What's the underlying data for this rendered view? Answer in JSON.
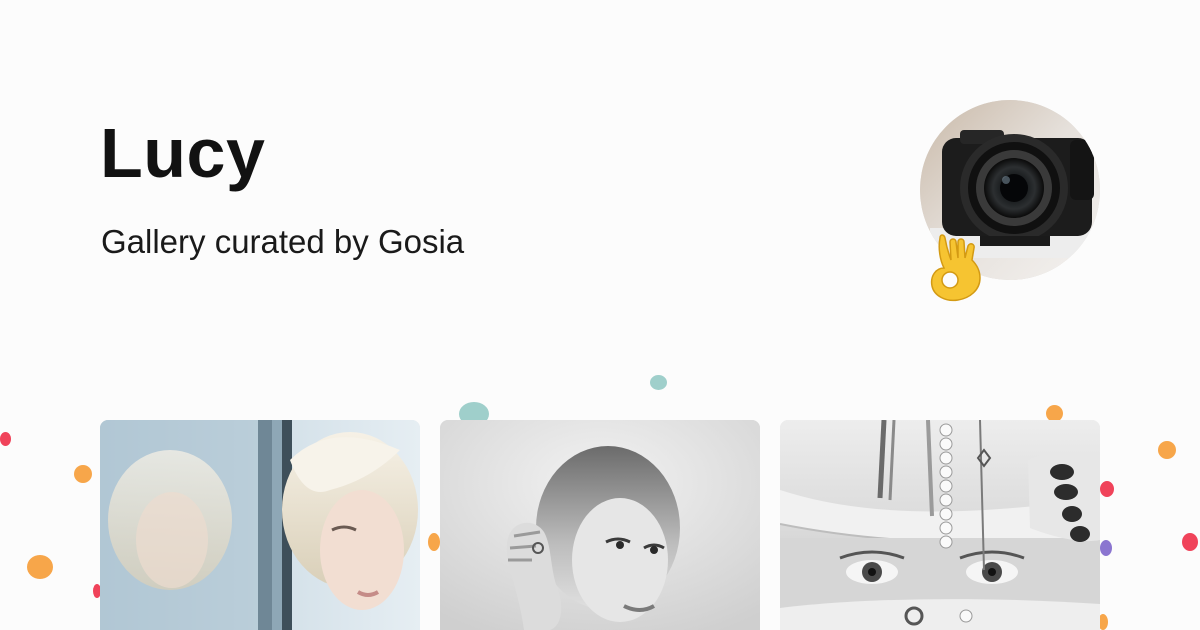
{
  "profile": {
    "name": "Lucy",
    "subtitle": "Gallery curated by Gosia"
  },
  "avatar": {
    "icon": "camera-photo",
    "badge_emoji": "ok-hand"
  },
  "gallery": {
    "photos": [
      {
        "icon": "photo-window-reflection"
      },
      {
        "icon": "photo-portrait-hand"
      },
      {
        "icon": "photo-bracelets-eyes"
      }
    ]
  },
  "colors": {
    "background": "#fcfcfc",
    "text": "#121212",
    "confetti_orange": "#f7a64a",
    "confetti_red": "#f0435a",
    "confetti_teal": "#9fcfcb",
    "confetti_purple": "#8b75d0"
  }
}
